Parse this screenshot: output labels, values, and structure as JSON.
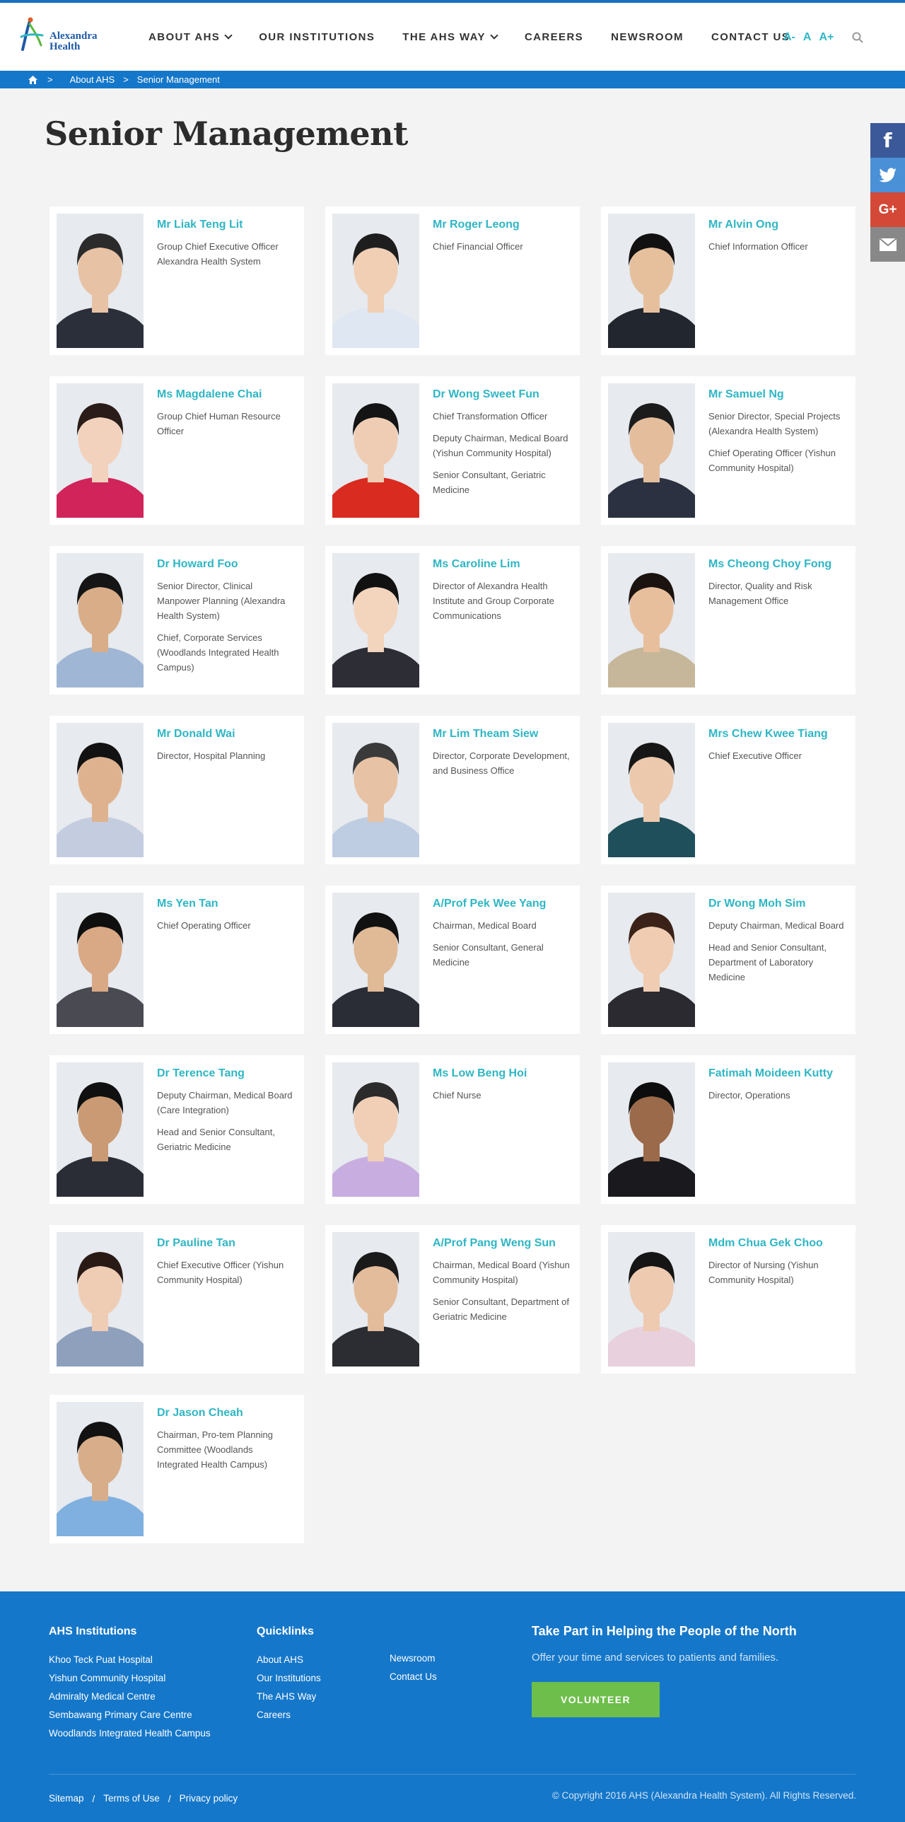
{
  "header": {
    "logo_line1": "Alexandra",
    "logo_line2": "Health",
    "nav": [
      {
        "label": "ABOUT AHS",
        "dropdown": true
      },
      {
        "label": "OUR INSTITUTIONS",
        "dropdown": false
      },
      {
        "label": "THE AHS WAY",
        "dropdown": true
      },
      {
        "label": "CAREERS",
        "dropdown": false
      },
      {
        "label": "NEWSROOM",
        "dropdown": false
      },
      {
        "label": "CONTACT US",
        "dropdown": false
      }
    ],
    "font_controls": [
      "A-",
      "A",
      "A+"
    ]
  },
  "breadcrumb": {
    "items": [
      "About AHS",
      "Senior Management"
    ],
    "separator": ">"
  },
  "page": {
    "title": "Senior Management"
  },
  "people": [
    {
      "name": "Mr Liak Teng Lit",
      "roles": [
        "Group Chief Executive Officer Alexandra Health System"
      ]
    },
    {
      "name": "Mr Roger Leong",
      "roles": [
        "Chief Financial Officer"
      ]
    },
    {
      "name": "Mr Alvin Ong",
      "roles": [
        "Chief Information Officer"
      ]
    },
    {
      "name": "Ms Magdalene Chai",
      "roles": [
        "Group Chief Human Resource Officer"
      ]
    },
    {
      "name": "Dr Wong Sweet Fun",
      "roles": [
        "Chief Transformation Officer",
        "Deputy Chairman, Medical Board (Yishun Community Hospital)",
        "Senior Consultant, Geriatric Medicine"
      ]
    },
    {
      "name": "Mr Samuel Ng",
      "roles": [
        "Senior Director, Special Projects (Alexandra Health System)",
        "Chief Operating Officer (Yishun Community Hospital)"
      ]
    },
    {
      "name": "Dr Howard Foo",
      "roles": [
        "Senior Director, Clinical Manpower Planning (Alexandra Health System)",
        "Chief, Corporate Services (Woodlands Integrated Health Campus)"
      ]
    },
    {
      "name": "Ms Caroline Lim",
      "roles": [
        "Director of Alexandra Health Institute and Group Corporate Communications"
      ]
    },
    {
      "name": "Ms Cheong Choy Fong",
      "roles": [
        "Director, Quality and Risk Management Office"
      ]
    },
    {
      "name": "Mr Donald Wai",
      "roles": [
        "Director, Hospital Planning"
      ]
    },
    {
      "name": "Mr Lim Theam Siew",
      "roles": [
        "Director, Corporate Development, and Business Office"
      ]
    },
    {
      "name": "Mrs Chew Kwee Tiang",
      "roles": [
        "Chief Executive Officer"
      ]
    },
    {
      "name": "Ms Yen Tan",
      "roles": [
        "Chief Operating Officer"
      ]
    },
    {
      "name": "A/Prof Pek Wee Yang",
      "roles": [
        "Chairman, Medical Board",
        "Senior Consultant, General Medicine"
      ]
    },
    {
      "name": "Dr Wong Moh Sim",
      "roles": [
        "Deputy Chairman, Medical Board",
        "Head and Senior Consultant, Department of Laboratory Medicine"
      ]
    },
    {
      "name": "Dr Terence Tang",
      "roles": [
        "Deputy Chairman, Medical Board (Care Integration)",
        "Head and Senior Consultant, Geriatric Medicine"
      ]
    },
    {
      "name": "Ms Low Beng Hoi",
      "roles": [
        "Chief Nurse"
      ]
    },
    {
      "name": "Fatimah Moideen Kutty",
      "roles": [
        "Director, Operations"
      ]
    },
    {
      "name": "Dr Pauline Tan",
      "roles": [
        "Chief Executive Officer (Yishun Community Hospital)"
      ]
    },
    {
      "name": "A/Prof Pang Weng Sun",
      "roles": [
        "Chairman, Medical Board (Yishun Community Hospital)",
        "Senior Consultant, Department of Geriatric Medicine"
      ]
    },
    {
      "name": "Mdm Chua Gek Choo",
      "roles": [
        "Director of Nursing (Yishun Community Hospital)"
      ]
    },
    {
      "name": "Dr Jason Cheah",
      "roles": [
        "Chairman, Pro-tem Planning Committee (Woodlands Integrated Health Campus)"
      ]
    }
  ],
  "social": {
    "facebook": "f",
    "googleplus": "G+"
  },
  "footer": {
    "institutions_heading": "AHS Institutions",
    "institutions": [
      "Khoo Teck Puat Hospital",
      "Yishun Community Hospital",
      "Admiralty Medical Centre",
      "Sembawang Primary Care Centre",
      "Woodlands Integrated Health Campus"
    ],
    "quicklinks_heading": "Quicklinks",
    "quicklinks_col1": [
      "About AHS",
      "Our Institutions",
      "The AHS Way",
      "Careers"
    ],
    "quicklinks_col2": [
      "Newsroom",
      "Contact Us"
    ],
    "cta_heading": "Take Part in Helping the People of the North",
    "cta_text": "Offer your time and services to patients and families.",
    "cta_button": "VOLUNTEER",
    "bottom_links": [
      "Sitemap",
      "Terms of Use",
      "Privacy policy"
    ],
    "bottom_separator": "/",
    "copyright": "© Copyright 2016 AHS (Alexandra Health System). All Rights Reserved."
  },
  "colors": {
    "accent": "#2fb6c4",
    "brand_blue": "#1577c9",
    "volunteer_green": "#6dbe4b"
  }
}
